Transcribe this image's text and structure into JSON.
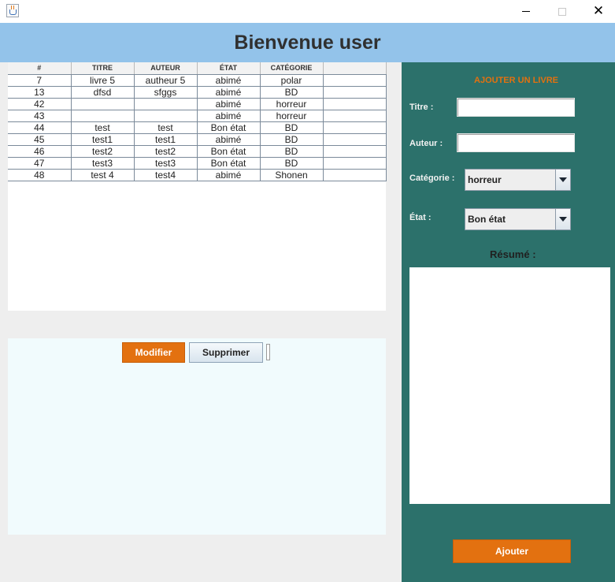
{
  "window": {
    "minimize_icon": "minimize-icon",
    "maximize_icon": "maximize-icon",
    "close_glyph": "✕"
  },
  "header": {
    "title": "Bienvenue user",
    "background": "#93c3ea"
  },
  "table": {
    "columns": [
      "#",
      "TITRE",
      "AUTEUR",
      "ÉTAT",
      "CATÉGORIE",
      ""
    ],
    "rows": [
      [
        "7",
        "livre 5",
        "autheur 5",
        "abimé",
        "polar",
        ""
      ],
      [
        "13",
        "dfsd",
        "sfggs",
        "abimé",
        "BD",
        ""
      ],
      [
        "42",
        "",
        "",
        "abimé",
        "horreur",
        ""
      ],
      [
        "43",
        "",
        "",
        "abimé",
        "horreur",
        ""
      ],
      [
        "44",
        "test",
        "test",
        "Bon état",
        "BD",
        ""
      ],
      [
        "45",
        "test1",
        "test1",
        "abimé",
        "BD",
        ""
      ],
      [
        "46",
        "test2",
        "test2",
        "Bon état",
        "BD",
        ""
      ],
      [
        "47",
        "test3",
        "test3",
        "Bon état",
        "BD",
        ""
      ],
      [
        "48",
        "test 4",
        "test4",
        "abimé",
        "Shonen",
        ""
      ]
    ]
  },
  "actions": {
    "modify_label": "Modifier",
    "delete_label": "Supprimer"
  },
  "form": {
    "title": "AJOUTER UN LIVRE",
    "titre_label": "Titre :",
    "titre_value": "",
    "auteur_label": "Auteur :",
    "auteur_value": "",
    "categorie_label": "Catégorie :",
    "categorie_value": "horreur",
    "etat_label": "État :",
    "etat_value": "Bon état",
    "resume_label": "Résumé :",
    "resume_value": "",
    "submit_label": "Ajouter"
  },
  "colors": {
    "accent": "#e37110",
    "panel": "#2c716b",
    "action_panel": "#f1fbfd"
  }
}
